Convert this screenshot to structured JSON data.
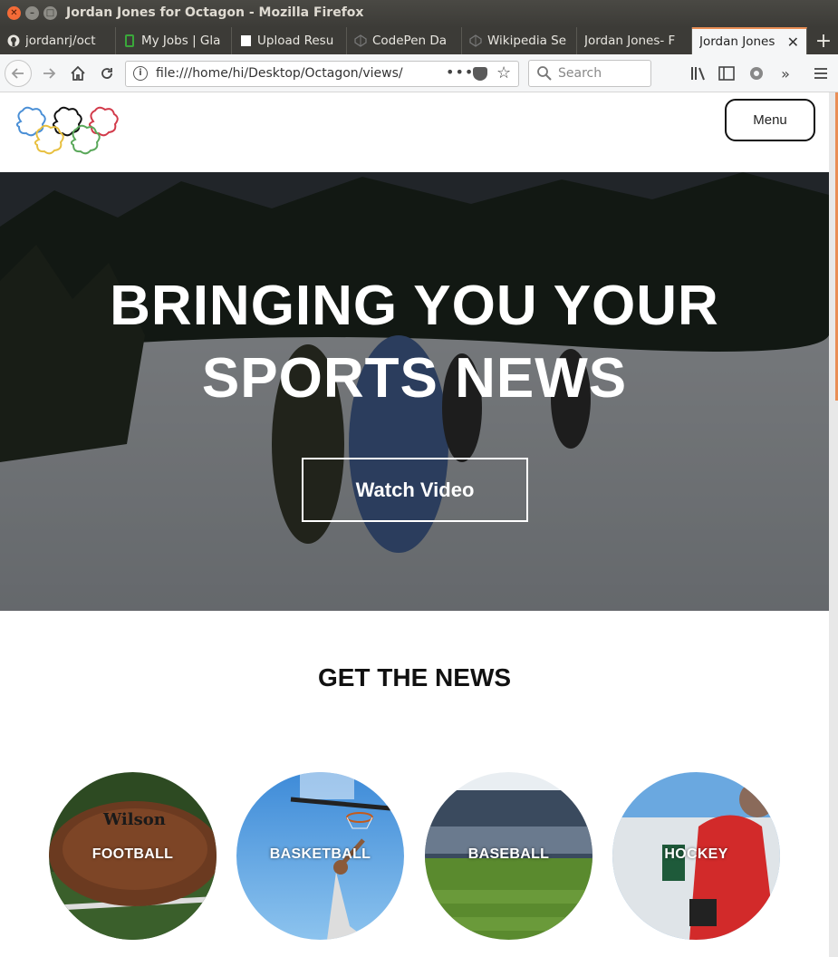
{
  "window": {
    "title": "Jordan Jones for Octagon - Mozilla Firefox"
  },
  "tabs": [
    {
      "label": "jordanrj/oct",
      "icon": "github-icon"
    },
    {
      "label": "My Jobs | Gla",
      "icon": "glassdoor-icon"
    },
    {
      "label": "Upload Resu",
      "icon": "page-icon"
    },
    {
      "label": "CodePen Da",
      "icon": "codepen-icon"
    },
    {
      "label": "Wikipedia Se",
      "icon": "codepen-icon"
    },
    {
      "label": "Jordan Jones- F",
      "icon": ""
    },
    {
      "label": "Jordan Jones",
      "icon": "",
      "active": true
    }
  ],
  "navbar": {
    "url": "file:///home/hi/Desktop/Octagon/views/",
    "search_placeholder": "Search"
  },
  "site": {
    "menu_label": "Menu",
    "hero": {
      "title_line1": "BRINGING YOU YOUR",
      "title_line2": "SPORTS NEWS",
      "cta": "Watch Video"
    },
    "section_title": "GET THE NEWS",
    "sports": [
      {
        "label": "FOOTBALL"
      },
      {
        "label": "BASKETBALL"
      },
      {
        "label": "BASEBALL"
      },
      {
        "label": "HOCKEY"
      }
    ]
  },
  "colors": {
    "accent": "#e98e55",
    "titlebar": "#3c3b37",
    "rings": [
      "#4a8fd6",
      "#111111",
      "#d23a4a",
      "#e8c040",
      "#5aa85a"
    ]
  }
}
